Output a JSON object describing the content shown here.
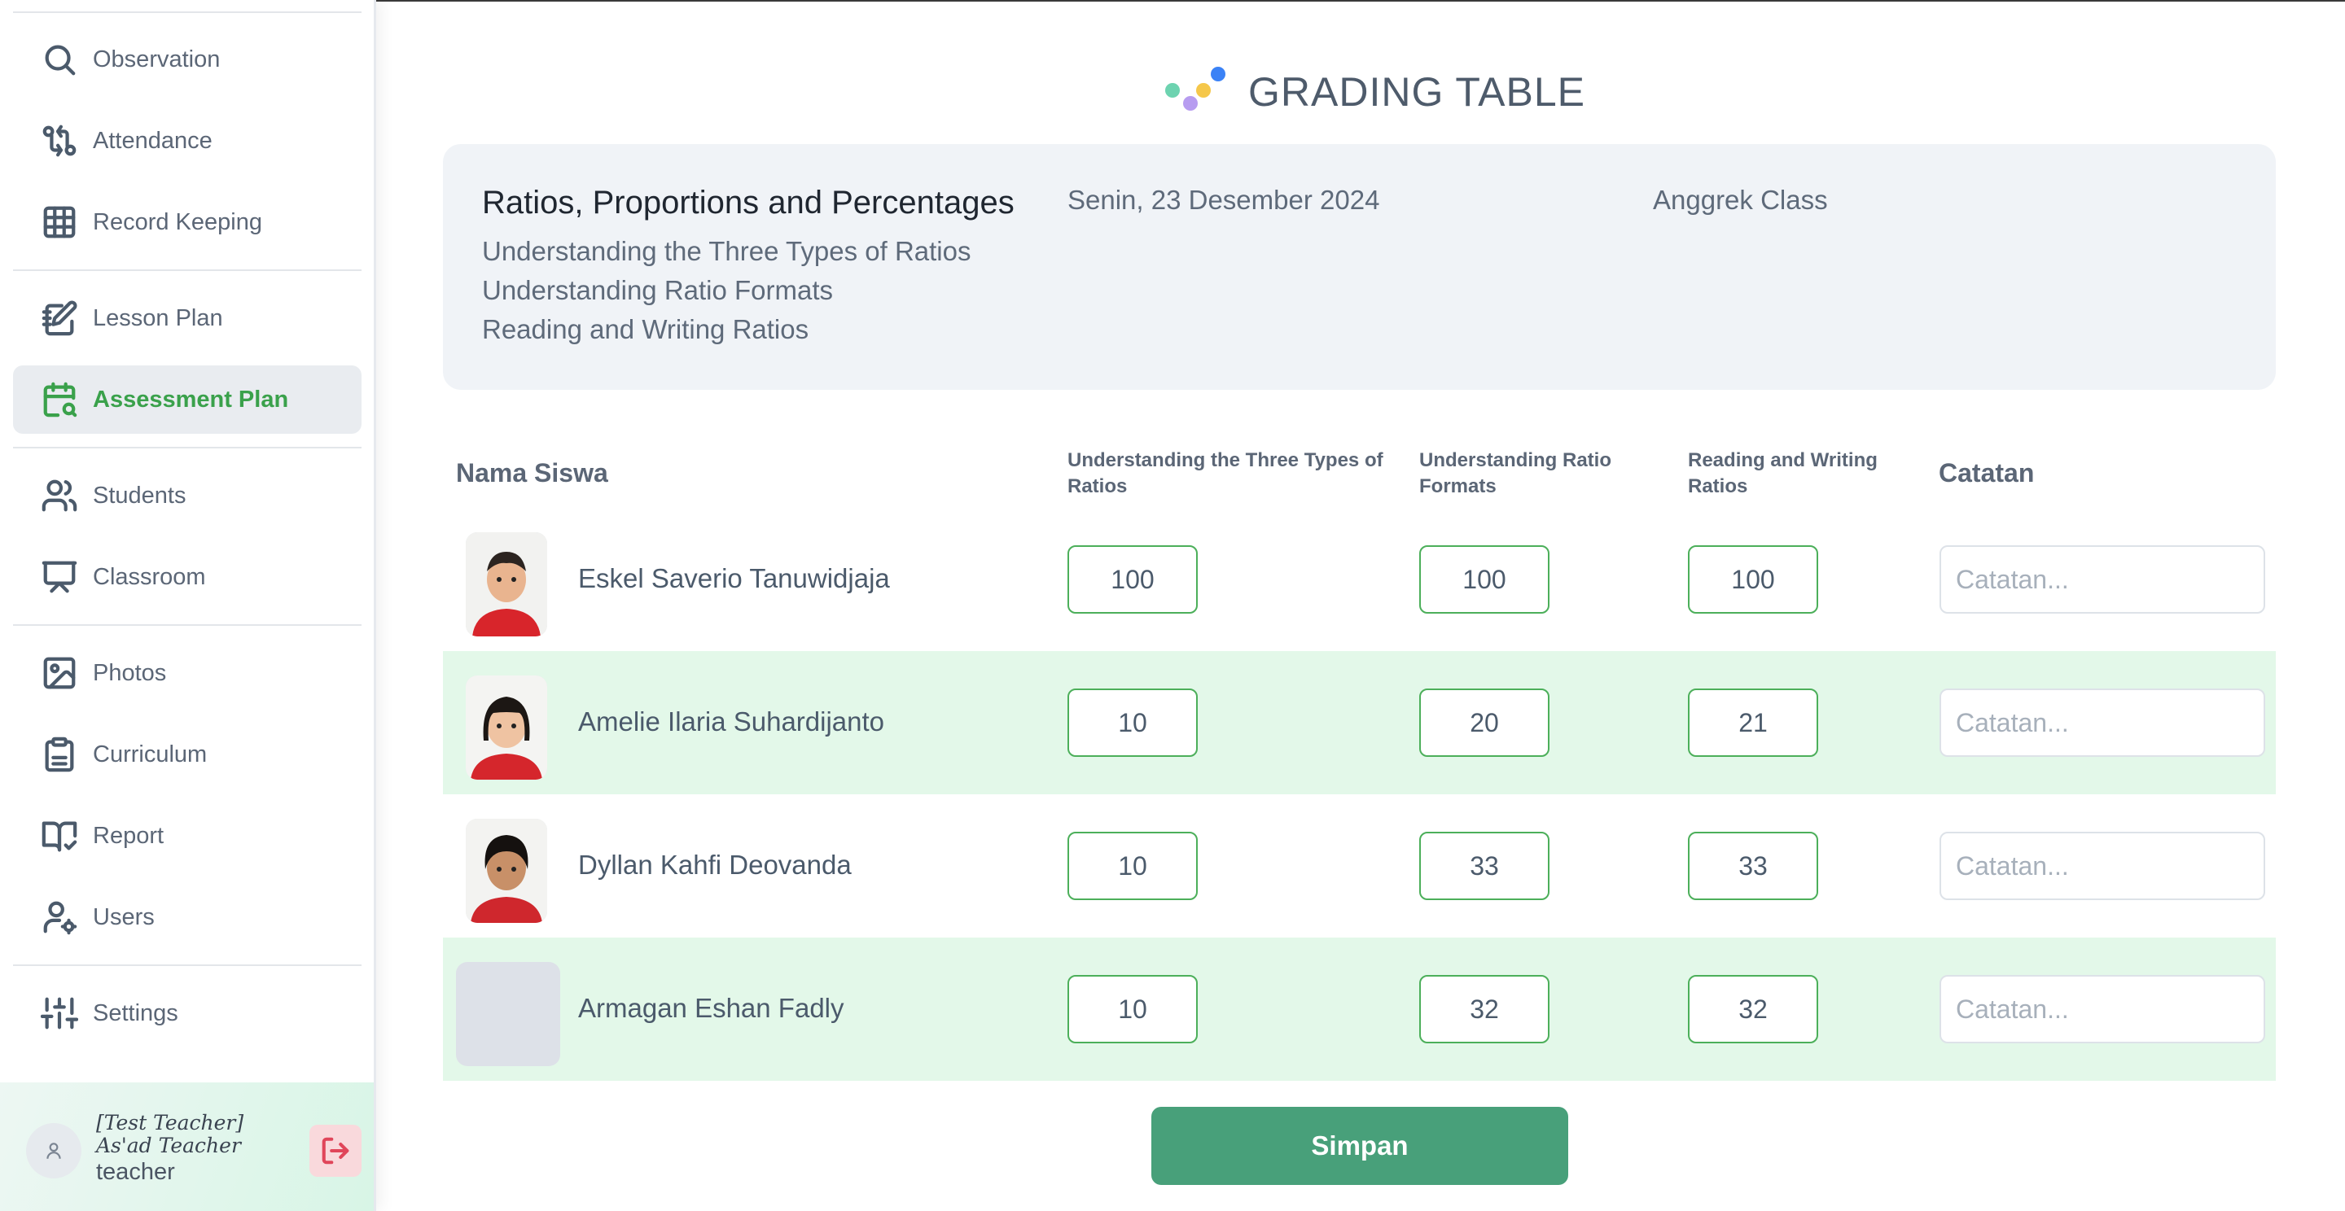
{
  "sidebar": {
    "items": [
      {
        "label": "Observation",
        "icon": "search-icon"
      },
      {
        "label": "Attendance",
        "icon": "git-compare-icon"
      },
      {
        "label": "Record Keeping",
        "icon": "grid-icon"
      },
      {
        "label": "Lesson Plan",
        "icon": "notebook-pen-icon"
      },
      {
        "label": "Assessment Plan",
        "icon": "calendar-search-icon",
        "active": true
      },
      {
        "label": "Students",
        "icon": "users-icon"
      },
      {
        "label": "Classroom",
        "icon": "presentation-icon"
      },
      {
        "label": "Photos",
        "icon": "image-icon"
      },
      {
        "label": "Curriculum",
        "icon": "clipboard-icon"
      },
      {
        "label": "Report",
        "icon": "book-check-icon"
      },
      {
        "label": "Users",
        "icon": "user-cog-icon"
      },
      {
        "label": "Settings",
        "icon": "sliders-icon"
      }
    ],
    "user": {
      "name": "[Test Teacher] As'ad Teacher",
      "role": "teacher"
    }
  },
  "main": {
    "title": "GRADING TABLE",
    "info": {
      "topic": "Ratios, Proportions and Percentages",
      "subtopics": [
        "Understanding the Three Types of Ratios",
        "Understanding Ratio Formats",
        "Reading and Writing Ratios"
      ],
      "date": "Senin, 23 Desember 2024",
      "class": "Anggrek Class"
    },
    "table": {
      "headers": {
        "name": "Nama Siswa",
        "col1": "Understanding the Three Types of Ratios",
        "col2": "Understanding Ratio Formats",
        "col3": "Reading and Writing Ratios",
        "notes": "Catatan"
      },
      "note_placeholder": "Catatan...",
      "rows": [
        {
          "name": "Eskel Saverio Tanuwidjaja",
          "scores": [
            "100",
            "100",
            "100"
          ],
          "note": ""
        },
        {
          "name": "Amelie Ilaria Suhardijanto",
          "scores": [
            "10",
            "20",
            "21"
          ],
          "note": ""
        },
        {
          "name": "Dyllan Kahfi Deovanda",
          "scores": [
            "10",
            "33",
            "33"
          ],
          "note": ""
        },
        {
          "name": "Armagan Eshan Fadly",
          "scores": [
            "10",
            "32",
            "32"
          ],
          "note": ""
        }
      ]
    },
    "save_label": "Simpan"
  },
  "colors": {
    "accent": "#3aa14b",
    "save_button": "#48a07a",
    "row_highlight": "#e3f8e9",
    "logout": "#e0465a"
  }
}
